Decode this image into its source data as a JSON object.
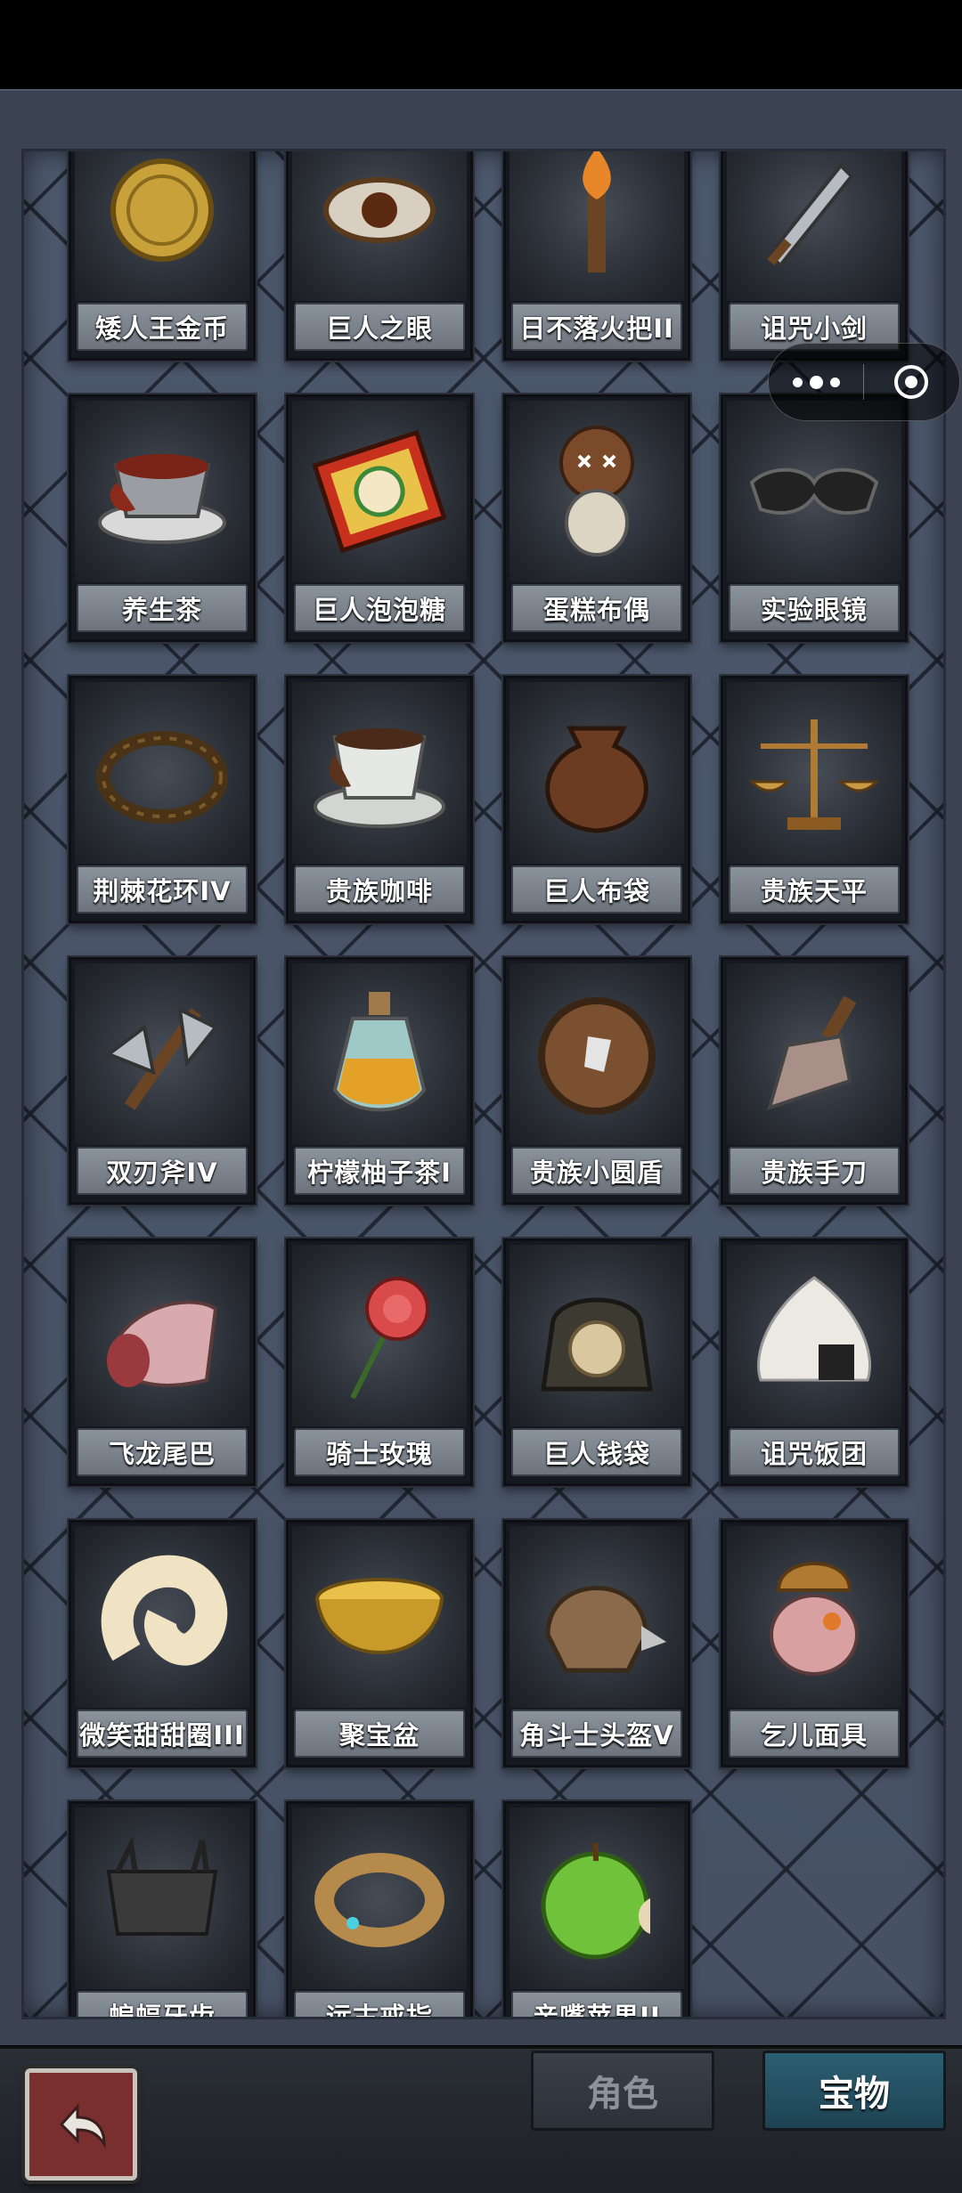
{
  "items": [
    {
      "name": "矮人王金币",
      "icon": "coin-icon"
    },
    {
      "name": "巨人之眼",
      "icon": "eye-icon"
    },
    {
      "name": "日不落火把II",
      "icon": "torch-icon"
    },
    {
      "name": "诅咒小剑",
      "icon": "sword-icon"
    },
    {
      "name": "养生茶",
      "icon": "teacup-icon"
    },
    {
      "name": "巨人泡泡糖",
      "icon": "gum-box-icon"
    },
    {
      "name": "蛋糕布偶",
      "icon": "voodoo-doll-icon"
    },
    {
      "name": "实验眼镜",
      "icon": "goggles-icon"
    },
    {
      "name": "荆棘花环IV",
      "icon": "thorn-wreath-icon"
    },
    {
      "name": "贵族咖啡",
      "icon": "coffee-cup-icon"
    },
    {
      "name": "巨人布袋",
      "icon": "sack-icon"
    },
    {
      "name": "贵族天平",
      "icon": "scales-icon"
    },
    {
      "name": "双刃斧IV",
      "icon": "double-axe-icon"
    },
    {
      "name": "柠檬柚子茶I",
      "icon": "potion-bottle-icon"
    },
    {
      "name": "贵族小圆盾",
      "icon": "round-shield-icon"
    },
    {
      "name": "贵族手刀",
      "icon": "cleaver-icon"
    },
    {
      "name": "飞龙尾巴",
      "icon": "dragon-tail-icon"
    },
    {
      "name": "骑士玫瑰",
      "icon": "rose-icon"
    },
    {
      "name": "巨人钱袋",
      "icon": "money-bag-icon"
    },
    {
      "name": "诅咒饭团",
      "icon": "rice-ball-icon"
    },
    {
      "name": "微笑甜甜圈III",
      "icon": "donut-icon"
    },
    {
      "name": "聚宝盆",
      "icon": "treasure-bowl-icon"
    },
    {
      "name": "角斗士头盔V",
      "icon": "helmet-icon"
    },
    {
      "name": "乞儿面具",
      "icon": "mask-icon"
    },
    {
      "name": "蝙蝠牙齿",
      "icon": "fangs-icon"
    },
    {
      "name": "远古戒指",
      "icon": "ring-icon"
    },
    {
      "name": "亲嘴苹果II",
      "icon": "apple-icon"
    }
  ],
  "tabs": {
    "character": "角色",
    "treasure": "宝物",
    "active": "treasure"
  },
  "colors": {
    "panel": "#3b4252",
    "card": "#15181e",
    "label": "#7d858f",
    "active_tab": "#2c5f73",
    "back_button": "#7a2f2f"
  }
}
